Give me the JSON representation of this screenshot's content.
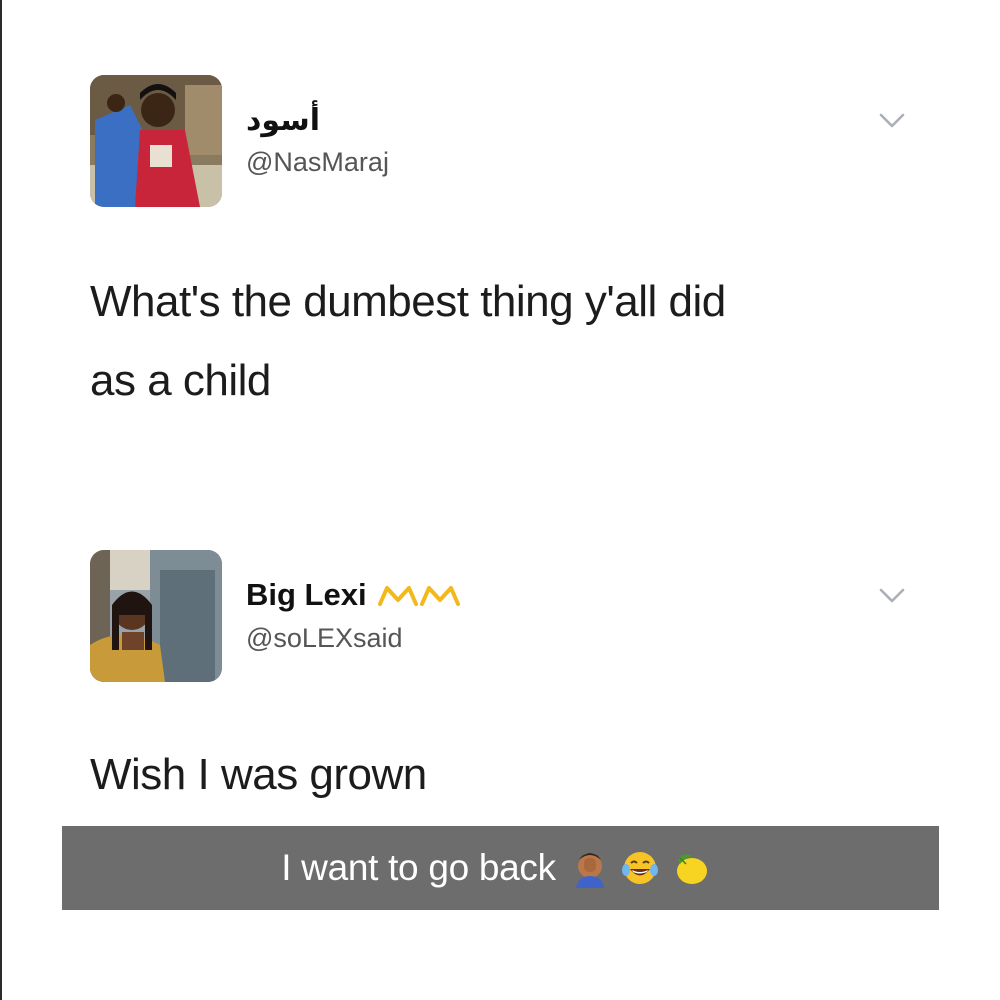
{
  "tweets": [
    {
      "display_name": "أسود",
      "handle": "@NasMaraj",
      "text_line1": "What's the dumbest thing y'all did",
      "text_line2": "as a child",
      "avatar_icon": "profile-photo-icon",
      "menu_icon": "chevron-down-icon"
    },
    {
      "display_name": "Big Lexi",
      "handle": "@soLEXsaid",
      "text_line1": "Wish I was grown",
      "name_emoji": [
        "crown-icon",
        "crown-icon"
      ],
      "avatar_icon": "profile-photo-icon",
      "menu_icon": "chevron-down-icon"
    }
  ],
  "caption": {
    "text": "I want to go back",
    "emoji": [
      "facepalm-icon",
      "tears-of-joy-icon",
      "lemon-icon"
    ]
  },
  "colors": {
    "background": "#ffffff",
    "caption_bar": "#6d6d6d",
    "caption_text": "#ffffff",
    "handle_text": "#555555"
  }
}
